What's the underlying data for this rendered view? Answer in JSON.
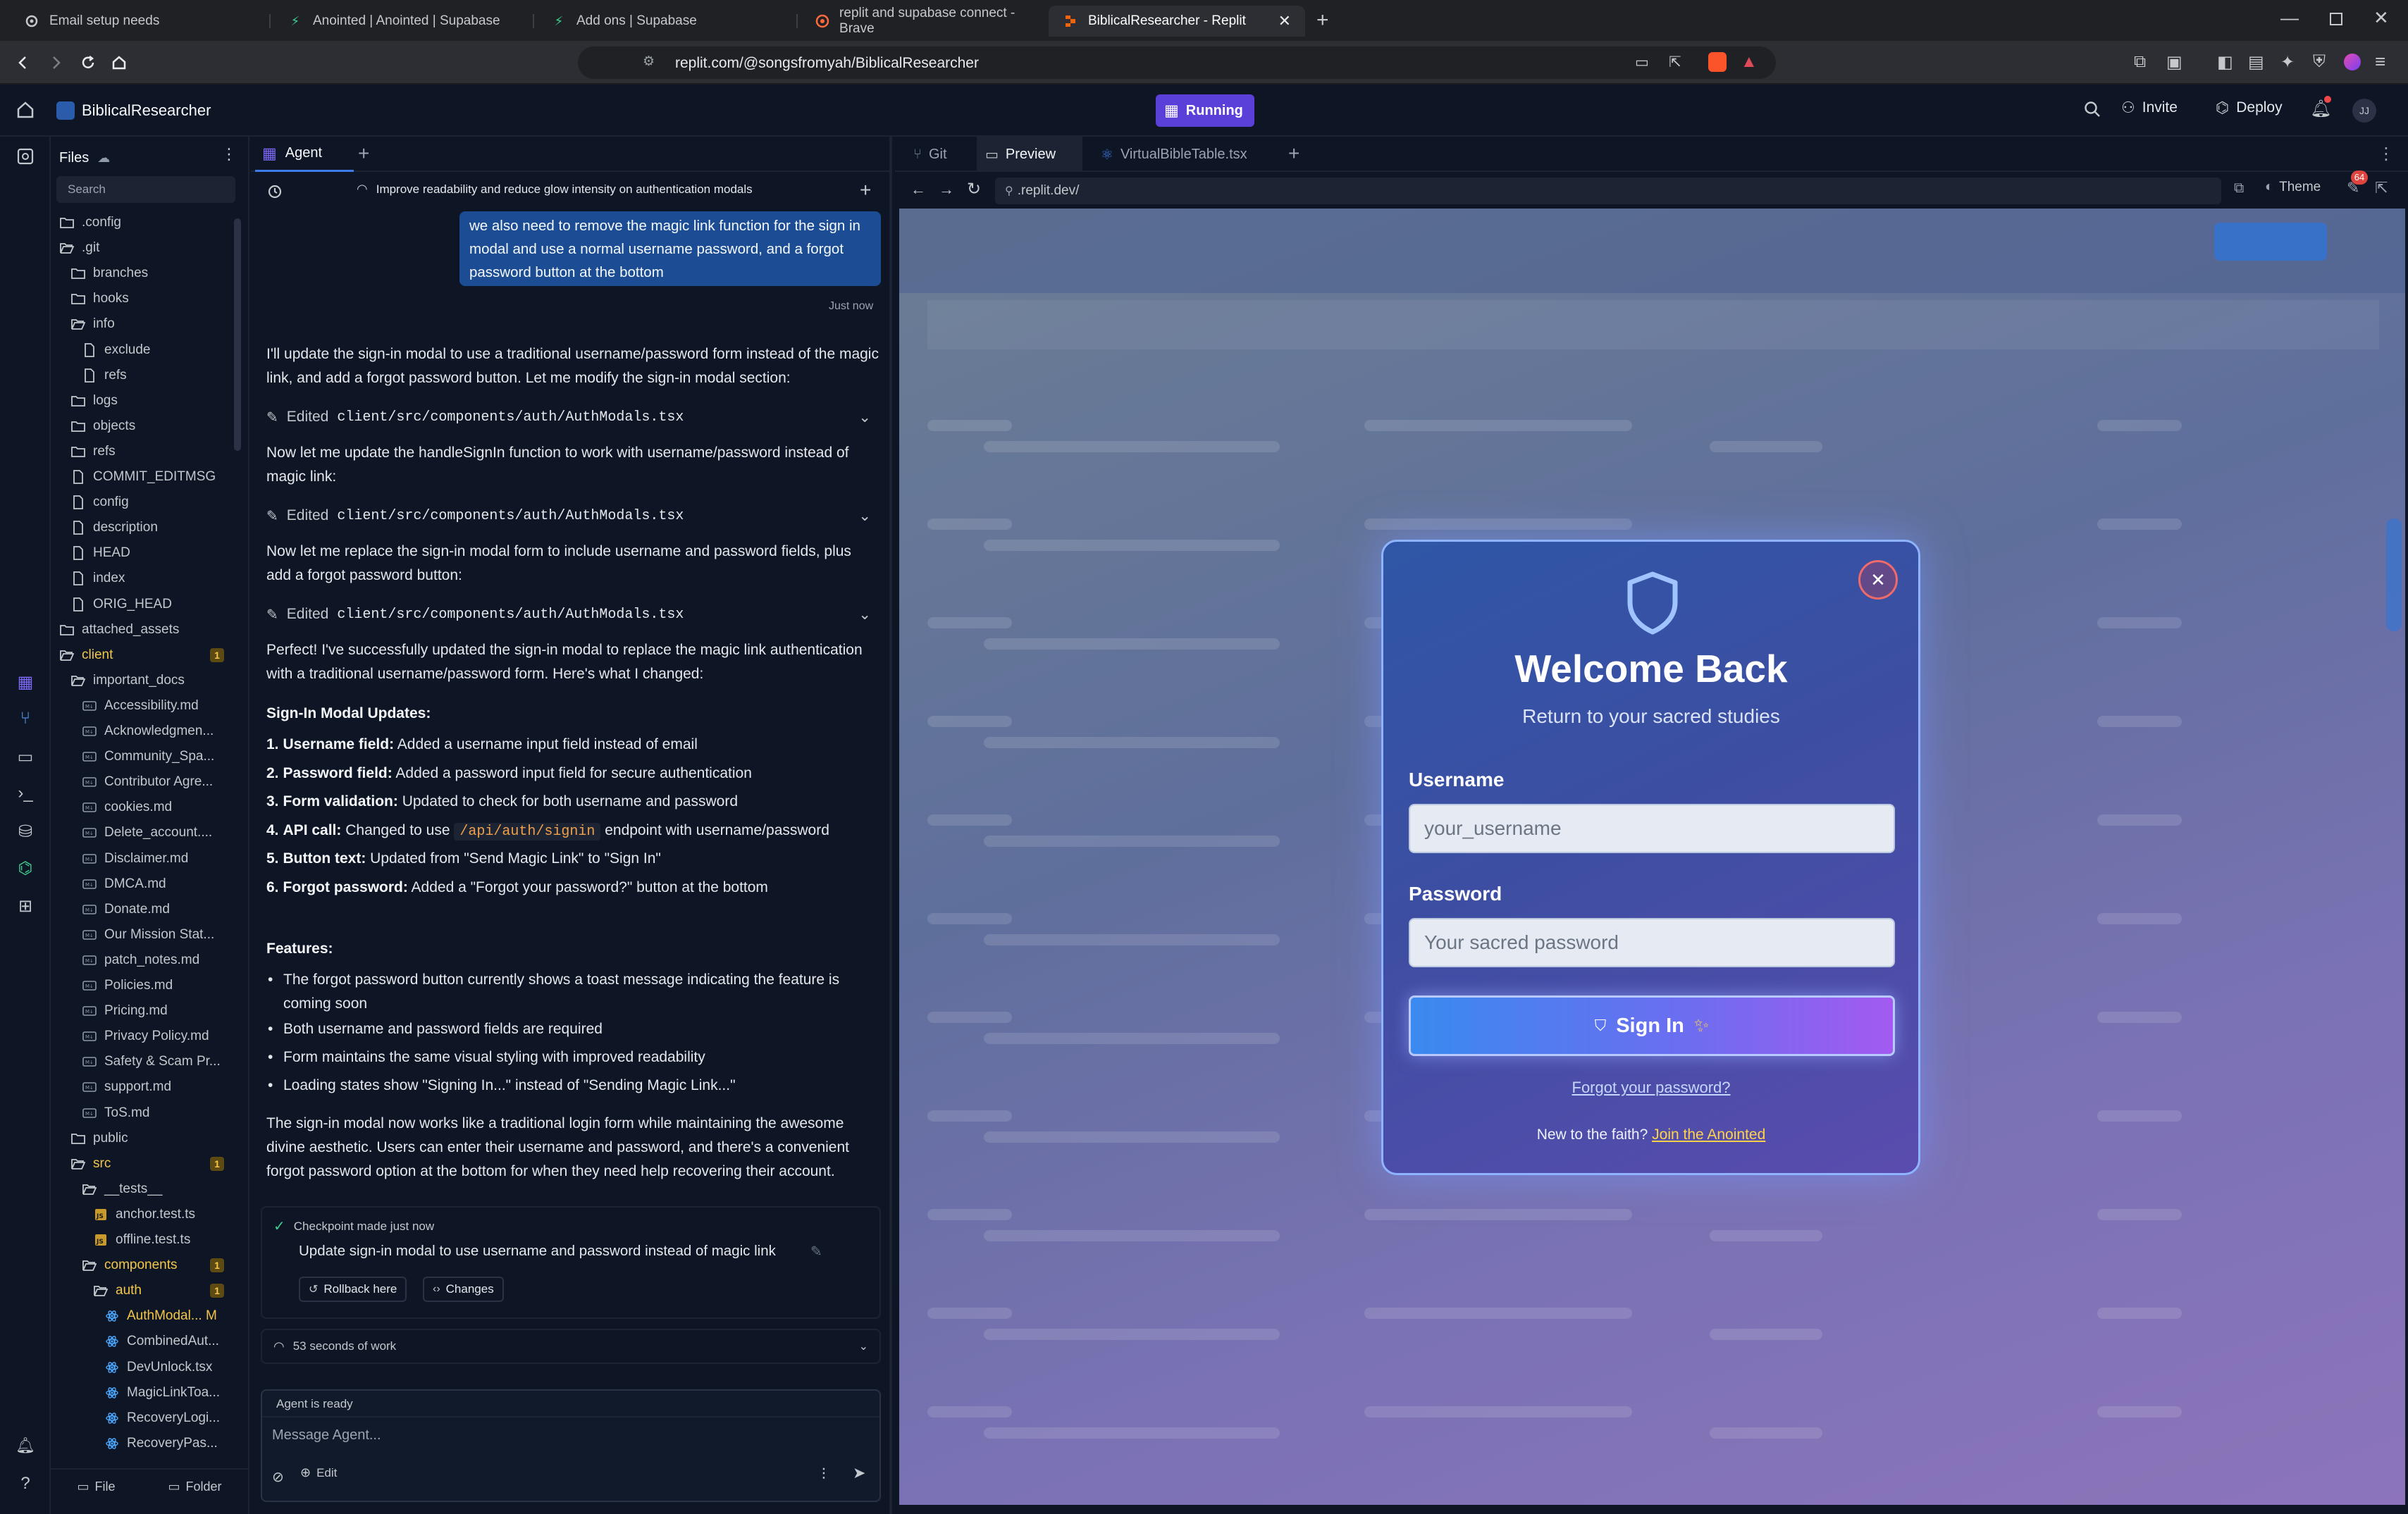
{
  "browser": {
    "tabs": [
      {
        "label": "Email setup needs",
        "icon": "gear-icon"
      },
      {
        "label": "Anointed | Anointed | Supabase",
        "icon": "supabase-icon"
      },
      {
        "label": "Add ons | Supabase",
        "icon": "supabase-icon"
      },
      {
        "label": "replit and supabase connect - Brave",
        "icon": "brave-search-icon"
      },
      {
        "label": "BiblicalResearcher - Replit",
        "icon": "replit-icon"
      }
    ],
    "url": "replit.com/@songsfromyah/BiblicalResearcher"
  },
  "header": {
    "project_name": "BiblicalResearcher",
    "status": "Running",
    "invite": "Invite",
    "deploy": "Deploy",
    "avatar": "JJ"
  },
  "files": {
    "title": "Files",
    "search_placeholder": "Search",
    "items": [
      {
        "name": ".config",
        "type": "folder",
        "depth": 0
      },
      {
        "name": ".git",
        "type": "folder-open",
        "depth": 0
      },
      {
        "name": "branches",
        "type": "folder",
        "depth": 1
      },
      {
        "name": "hooks",
        "type": "folder",
        "depth": 1
      },
      {
        "name": "info",
        "type": "folder-open",
        "depth": 1
      },
      {
        "name": "exclude",
        "type": "file",
        "depth": 2
      },
      {
        "name": "refs",
        "type": "file",
        "depth": 2
      },
      {
        "name": "logs",
        "type": "folder",
        "depth": 1
      },
      {
        "name": "objects",
        "type": "folder",
        "depth": 1
      },
      {
        "name": "refs",
        "type": "folder",
        "depth": 1
      },
      {
        "name": "COMMIT_EDITMSG",
        "type": "file",
        "depth": 1
      },
      {
        "name": "config",
        "type": "file",
        "depth": 1
      },
      {
        "name": "description",
        "type": "file",
        "depth": 1
      },
      {
        "name": "HEAD",
        "type": "file",
        "depth": 1
      },
      {
        "name": "index",
        "type": "file",
        "depth": 1
      },
      {
        "name": "ORIG_HEAD",
        "type": "file",
        "depth": 1
      },
      {
        "name": "attached_assets",
        "type": "folder",
        "depth": 0
      },
      {
        "name": "client",
        "type": "folder-open",
        "depth": 0,
        "badge": "1"
      },
      {
        "name": "important_docs",
        "type": "folder-open",
        "depth": 1
      },
      {
        "name": "Accessibility.md",
        "type": "md",
        "depth": 2
      },
      {
        "name": "Acknowledgmen...",
        "type": "md",
        "depth": 2
      },
      {
        "name": "Community_Spa...",
        "type": "md",
        "depth": 2
      },
      {
        "name": "Contributor Agre...",
        "type": "md",
        "depth": 2
      },
      {
        "name": "cookies.md",
        "type": "md",
        "depth": 2
      },
      {
        "name": "Delete_account....",
        "type": "md",
        "depth": 2
      },
      {
        "name": "Disclaimer.md",
        "type": "md",
        "depth": 2
      },
      {
        "name": "DMCA.md",
        "type": "md",
        "depth": 2
      },
      {
        "name": "Donate.md",
        "type": "md",
        "depth": 2
      },
      {
        "name": "Our Mission Stat...",
        "type": "md",
        "depth": 2
      },
      {
        "name": "patch_notes.md",
        "type": "md",
        "depth": 2
      },
      {
        "name": "Policies.md",
        "type": "md",
        "depth": 2
      },
      {
        "name": "Pricing.md",
        "type": "md",
        "depth": 2
      },
      {
        "name": "Privacy Policy.md",
        "type": "md",
        "depth": 2
      },
      {
        "name": "Safety & Scam Pr...",
        "type": "md",
        "depth": 2
      },
      {
        "name": "support.md",
        "type": "md",
        "depth": 2
      },
      {
        "name": "ToS.md",
        "type": "md",
        "depth": 2
      },
      {
        "name": "public",
        "type": "folder",
        "depth": 1
      },
      {
        "name": "src",
        "type": "folder-open",
        "depth": 1,
        "badge": "1"
      },
      {
        "name": "__tests__",
        "type": "folder-open",
        "depth": 2
      },
      {
        "name": "anchor.test.ts",
        "type": "ts",
        "depth": 3
      },
      {
        "name": "offline.test.ts",
        "type": "ts",
        "depth": 3
      },
      {
        "name": "components",
        "type": "folder-open",
        "depth": 2,
        "badge": "1"
      },
      {
        "name": "auth",
        "type": "folder-open",
        "depth": 3,
        "badge": "1"
      },
      {
        "name": "AuthModal... M",
        "type": "tsx",
        "depth": 4,
        "modified": true
      },
      {
        "name": "CombinedAut...",
        "type": "tsx",
        "depth": 4
      },
      {
        "name": "DevUnlock.tsx",
        "type": "tsx",
        "depth": 4
      },
      {
        "name": "MagicLinkToa...",
        "type": "tsx",
        "depth": 4
      },
      {
        "name": "RecoveryLogi...",
        "type": "tsx",
        "depth": 4
      },
      {
        "name": "RecoveryPas...",
        "type": "tsx",
        "depth": 4
      }
    ],
    "bottom": {
      "file": "File",
      "folder": "Folder"
    }
  },
  "agent": {
    "tab": "Agent",
    "thread_title": "Improve readability and reduce glow intensity on authentication modals",
    "user_message": "we also need to remove the magic link function for the sign in modal and use a normal username password, and a forgot password button at the bottom",
    "user_time": "Just now",
    "msg1": "I'll update the sign-in modal to use a traditional username/password form instead of the magic link, and add a forgot password button. Let me modify the sign-in modal section:",
    "edited_label": "Edited",
    "edited_file": "client/src/components/auth/AuthModals.tsx",
    "msg2": "Now let me update the handleSignIn function to work with username/password instead of magic link:",
    "msg3": "Now let me replace the sign-in modal form to include username and password fields, plus add a forgot password button:",
    "msg4": "Perfect! I've successfully updated the sign-in modal to replace the magic link authentication with a traditional username/password form. Here's what I changed:",
    "updates_heading": "Sign-In Modal Updates:",
    "updates": [
      {
        "n": "1.",
        "b": "Username field:",
        "t": " Added a username input field instead of email"
      },
      {
        "n": "2.",
        "b": "Password field:",
        "t": " Added a password input field for secure authentication"
      },
      {
        "n": "3.",
        "b": "Form validation:",
        "t": " Updated to check for both username and password"
      },
      {
        "n": "4.",
        "b": "API call:",
        "t": " Changed to use ",
        "code": "/api/auth/signin",
        "t2": " endpoint with username/password"
      },
      {
        "n": "5.",
        "b": "Button text:",
        "t": " Updated from \"Send Magic Link\" to \"Sign In\""
      },
      {
        "n": "6.",
        "b": "Forgot password:",
        "t": " Added a \"Forgot your password?\" button at the bottom"
      }
    ],
    "features_heading": "Features:",
    "features": [
      "The forgot password button currently shows a toast message indicating the feature is coming soon",
      "Both username and password fields are required",
      "Form maintains the same visual styling with improved readability",
      "Loading states show \"Signing In...\" instead of \"Sending Magic Link...\""
    ],
    "msg5": "The sign-in modal now works like a traditional login form while maintaining the awesome divine aesthetic. Users can enter their username and password, and there's a convenient forgot password option at the bottom for when they need help recovering their account.",
    "checkpoint_label": "Checkpoint made just now",
    "checkpoint_desc": "Update sign-in modal to use username and password instead of magic link",
    "rollback": "Rollback here",
    "changes": "Changes",
    "work_time": "53 seconds of work",
    "status": "Agent is ready",
    "input_placeholder": "Message Agent...",
    "edit_label": "Edit"
  },
  "preview": {
    "tabs": [
      "Git",
      "Preview",
      "VirtualBibleTable.tsx"
    ],
    "url": ".replit.dev/",
    "theme": "Theme",
    "notif_count": "64"
  },
  "modal": {
    "title": "Welcome Back",
    "subtitle": "Return to your sacred studies",
    "username_label": "Username",
    "username_placeholder": "your_username",
    "password_label": "Password",
    "password_placeholder": "Your sacred password",
    "signin_button": "Sign In",
    "forgot": "Forgot your password?",
    "new_text": "New to the faith?",
    "join": "Join the Anointed"
  },
  "colors": {
    "accent_blue": "#3d7be8",
    "running_purple": "#5b3fd9",
    "badge_yellow": "#f3c64a"
  }
}
